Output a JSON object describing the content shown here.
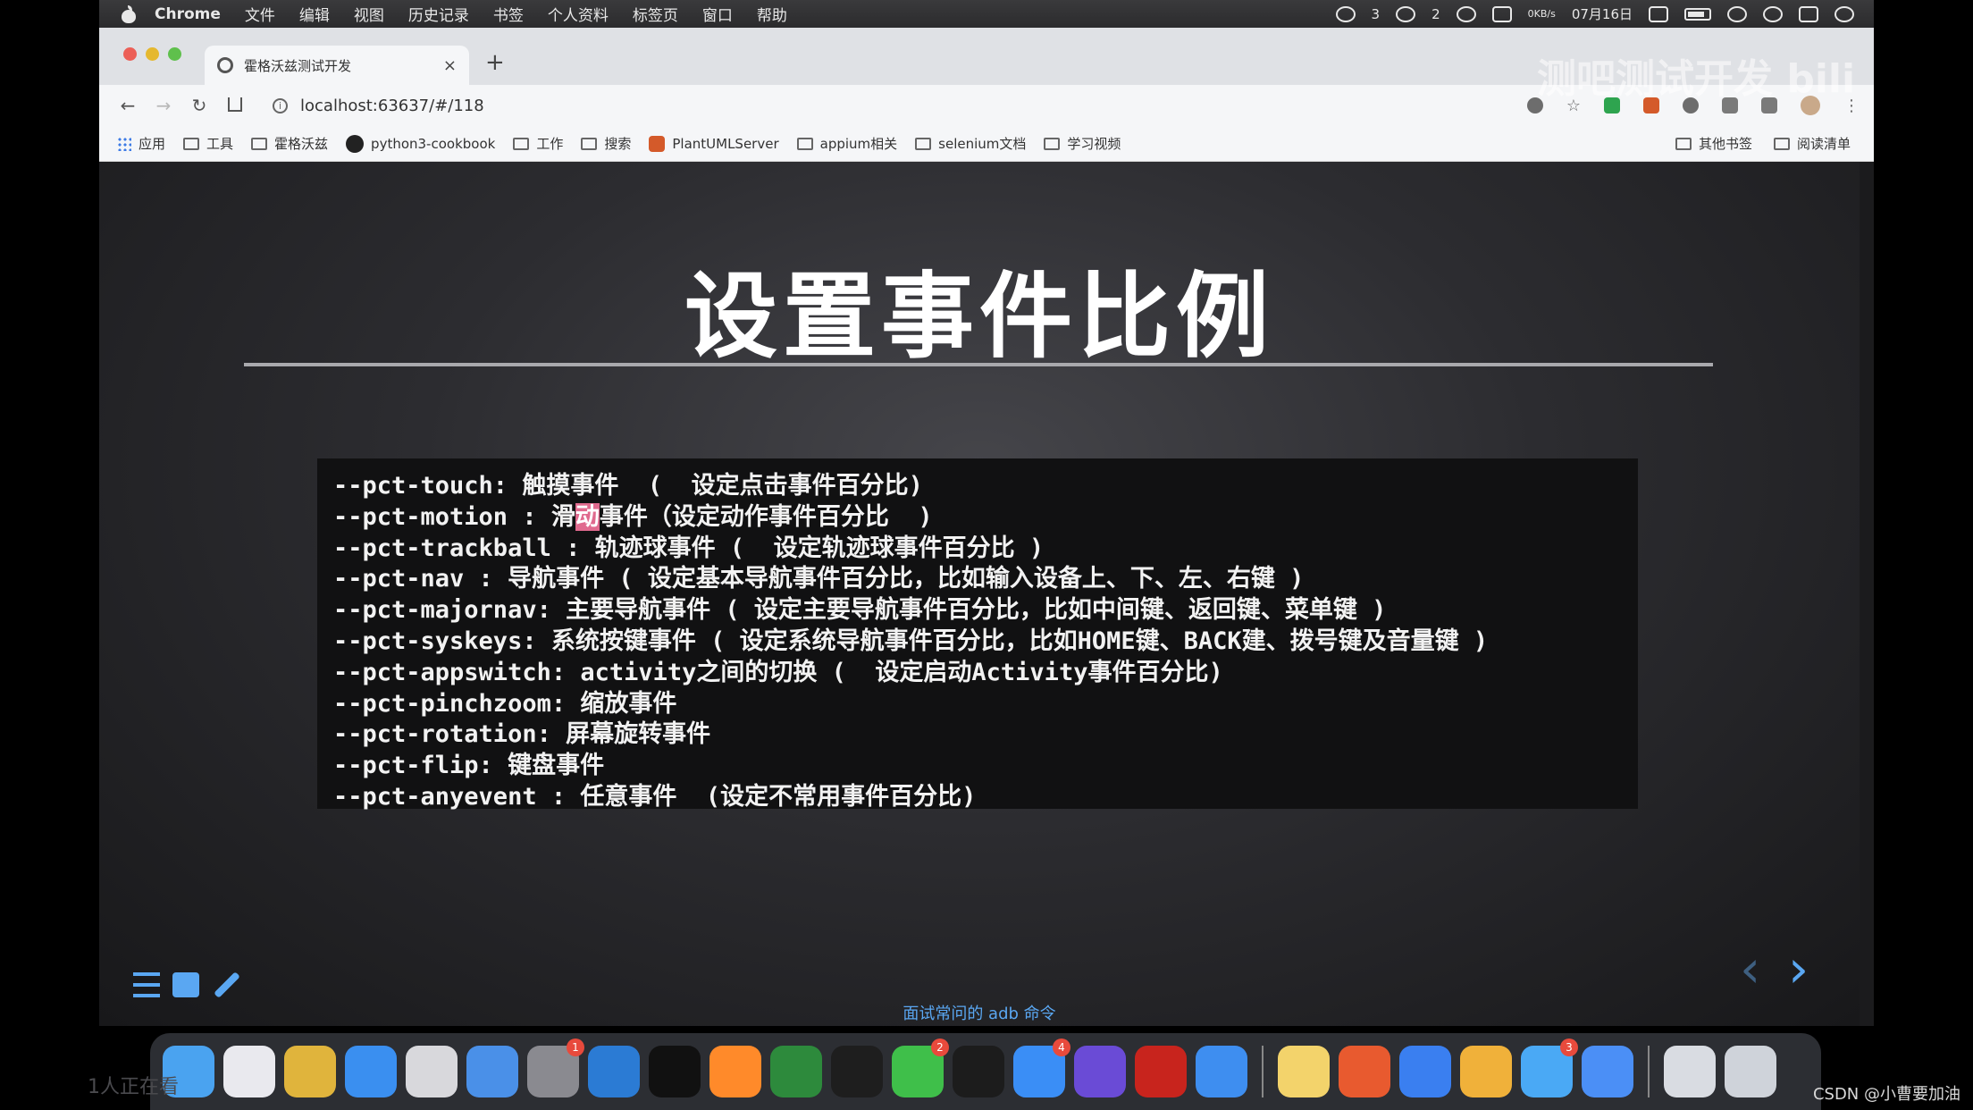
{
  "menubar": {
    "app": "Chrome",
    "items": [
      "文件",
      "编辑",
      "视图",
      "历史记录",
      "书签",
      "个人资料",
      "标签页",
      "窗口",
      "帮助"
    ],
    "status": {
      "chat_count": "3",
      "wechat_count": "2",
      "net_speed": "0KB/s",
      "date": "07月16日"
    }
  },
  "browser": {
    "tab_title": "霍格沃兹测试开发",
    "close_label": "×",
    "new_tab_label": "+",
    "url": "localhost:63637/#/118",
    "bookmarks": [
      "应用",
      "工具",
      "霍格沃兹",
      "python3-cookbook",
      "工作",
      "搜索",
      "PlantUMLServer",
      "appium相关",
      "selenium文档",
      "学习视频"
    ],
    "bookmarks_right": [
      "其他书签",
      "阅读清单"
    ]
  },
  "slide": {
    "title": "设置事件比例",
    "lines": [
      {
        "pre": "--pct-touch: 触摸事件  (  设定点击事件百分比)",
        "mark": "",
        "post": ""
      },
      {
        "pre": "--pct-motion : 滑",
        "mark": "动",
        "post": "事件（设定动作事件百分比  )"
      },
      {
        "pre": "--pct-trackball : 轨迹球事件 (  设定轨迹球事件百分比 )",
        "mark": "",
        "post": ""
      },
      {
        "pre": "--pct-nav : 导航事件 ( 设定基本导航事件百分比，比如输入设备上、下、左、右键 )",
        "mark": "",
        "post": ""
      },
      {
        "pre": "--pct-majornav: 主要导航事件 ( 设定主要导航事件百分比，比如中间键、返回键、菜单键 )",
        "mark": "",
        "post": ""
      },
      {
        "pre": "--pct-syskeys: 系统按键事件 ( 设定系统导航事件百分比，比如HOME键、BACK建、拨号键及音量键 )",
        "mark": "",
        "post": ""
      },
      {
        "pre": "--pct-appswitch: activity之间的切换 (  设定启动Activity事件百分比)",
        "mark": "",
        "post": ""
      },
      {
        "pre": "--pct-pinchzoom: 缩放事件",
        "mark": "",
        "post": ""
      },
      {
        "pre": "--pct-rotation: 屏幕旋转事件",
        "mark": "",
        "post": ""
      },
      {
        "pre": "--pct-flip: 键盘事件",
        "mark": "",
        "post": ""
      },
      {
        "pre": "--pct-anyevent : 任意事件  (设定不常用事件百分比)",
        "mark": "",
        "post": ""
      }
    ],
    "prev_label": "‹",
    "next_label": "›",
    "caption": "面试常问的 adb 命令"
  },
  "overlay": {
    "watermark": "测吧测试开发",
    "bili": "bili",
    "viewers": "1人正在看",
    "csdn": "CSDN @小曹要加油"
  },
  "dock": {
    "icons": [
      {
        "name": "finder-icon",
        "color": "#4aa3f0"
      },
      {
        "name": "launchpad-icon",
        "color": "#e9e9ee"
      },
      {
        "name": "chrome-icon",
        "color": "#e0b43c"
      },
      {
        "name": "safari-icon",
        "color": "#3a8ff0"
      },
      {
        "name": "keynote-icon",
        "color": "#d8d8dc"
      },
      {
        "name": "testflight-icon",
        "color": "#4a90e8"
      },
      {
        "name": "system-preferences-icon",
        "color": "#8a8a90",
        "badge": "1"
      },
      {
        "name": "vscode-icon",
        "color": "#2b7bd4"
      },
      {
        "name": "pycharm-icon",
        "color": "#111111"
      },
      {
        "name": "sublime-icon",
        "color": "#ff8a2a"
      },
      {
        "name": "evernote-icon",
        "color": "#2d8a3c"
      },
      {
        "name": "terminal-icon",
        "color": "#1e1e1e"
      },
      {
        "name": "wechat-icon",
        "color": "#3fbf4a",
        "badge": "2"
      },
      {
        "name": "qq-icon",
        "color": "#1c1c1c"
      },
      {
        "name": "app-store-icon",
        "color": "#3a8ef6",
        "badge": "4"
      },
      {
        "name": "instruments-icon",
        "color": "#6a4bd6"
      },
      {
        "name": "filezilla-icon",
        "color": "#c8241d"
      },
      {
        "name": "pencil-app-icon",
        "color": "#3e8ef0"
      },
      {
        "name": "sep"
      },
      {
        "name": "notes-icon",
        "color": "#f3d36b"
      },
      {
        "name": "xmind-icon",
        "color": "#e85a2f"
      },
      {
        "name": "feishu-icon",
        "color": "#3a7ff0"
      },
      {
        "name": "cube-app-icon",
        "color": "#f0b13a"
      },
      {
        "name": "chat-app-icon",
        "color": "#4aa9f5",
        "badge": "3"
      },
      {
        "name": "lark-icon",
        "color": "#4b8ff6"
      },
      {
        "name": "sep"
      },
      {
        "name": "screen-icon",
        "color": "#d9dce2"
      },
      {
        "name": "trash-icon",
        "color": "#cfd3da"
      }
    ]
  }
}
